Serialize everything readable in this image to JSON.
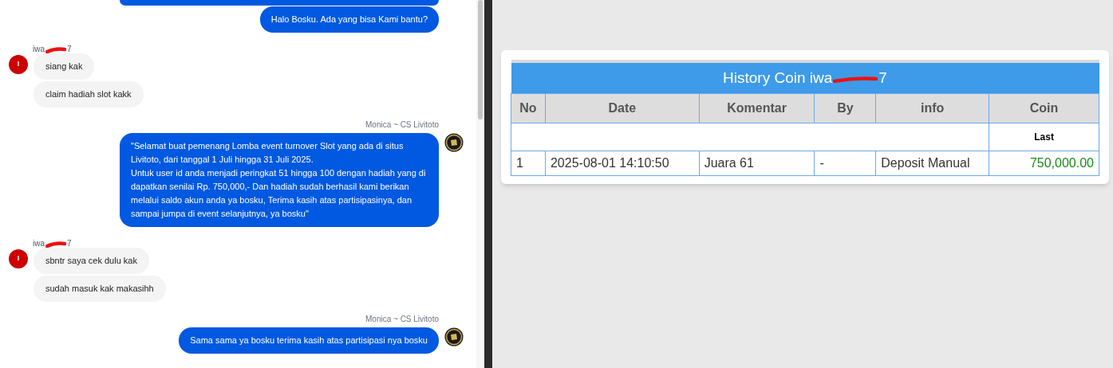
{
  "chat": {
    "groups": [
      {
        "outgoing": true,
        "kind": "clipped"
      },
      {
        "outgoing": true,
        "kind": "messages",
        "bubbles": [
          "Halo Bosku. Ada yang bisa Kami bantu?"
        ]
      },
      {
        "outgoing": false,
        "kind": "messages",
        "sender": {
          "start": "iwa",
          "end": "7"
        },
        "avatar": "I",
        "bubbles": [
          "siang kak",
          "claim hadiah slot kakk"
        ]
      },
      {
        "outgoing": true,
        "kind": "messages",
        "sender": {
          "start": "Monica ~ CS Livitoto"
        },
        "bubbles": [
          "\"Selamat buat pemenang Lomba event turnover Slot yang ada di situs Livitoto, dari tanggal 1 Juli hingga 31 Juli 2025.\nUntuk user id anda menjadi peringkat 51 hingga 100 dengan hadiah yang di dapatkan senilai Rp. 750,000,- Dan hadiah sudah berhasil kami berikan melalui saldo akun anda ya bosku, Terima kasih atas partisipasinya, dan sampai jumpa di event selanjutnya, ya bosku\""
        ]
      },
      {
        "outgoing": false,
        "kind": "messages",
        "sender": {
          "start": "iwa",
          "end": "7"
        },
        "avatar": "I",
        "bubbles": [
          "sbntr saya cek dulu kak",
          "sudah masuk kak makasihh"
        ]
      },
      {
        "outgoing": true,
        "kind": "messages",
        "sender": {
          "start": "Monica ~ CS Livitoto"
        },
        "bubbles": [
          "Sama sama ya bosku terima kasih atas partisipasi nya bosku"
        ]
      }
    ]
  },
  "history": {
    "title": {
      "start": "History Coin iwa",
      "end": "7"
    },
    "columns": [
      "No",
      "Date",
      "Komentar",
      "By",
      "info",
      "Coin"
    ],
    "subheader": "Last",
    "rows": [
      {
        "no": "1",
        "date": "2025-08-01 14:10:50",
        "komentar": "Juara 61",
        "by": "-",
        "info": "Deposit Manual",
        "coin": "750,000.00"
      }
    ]
  }
}
